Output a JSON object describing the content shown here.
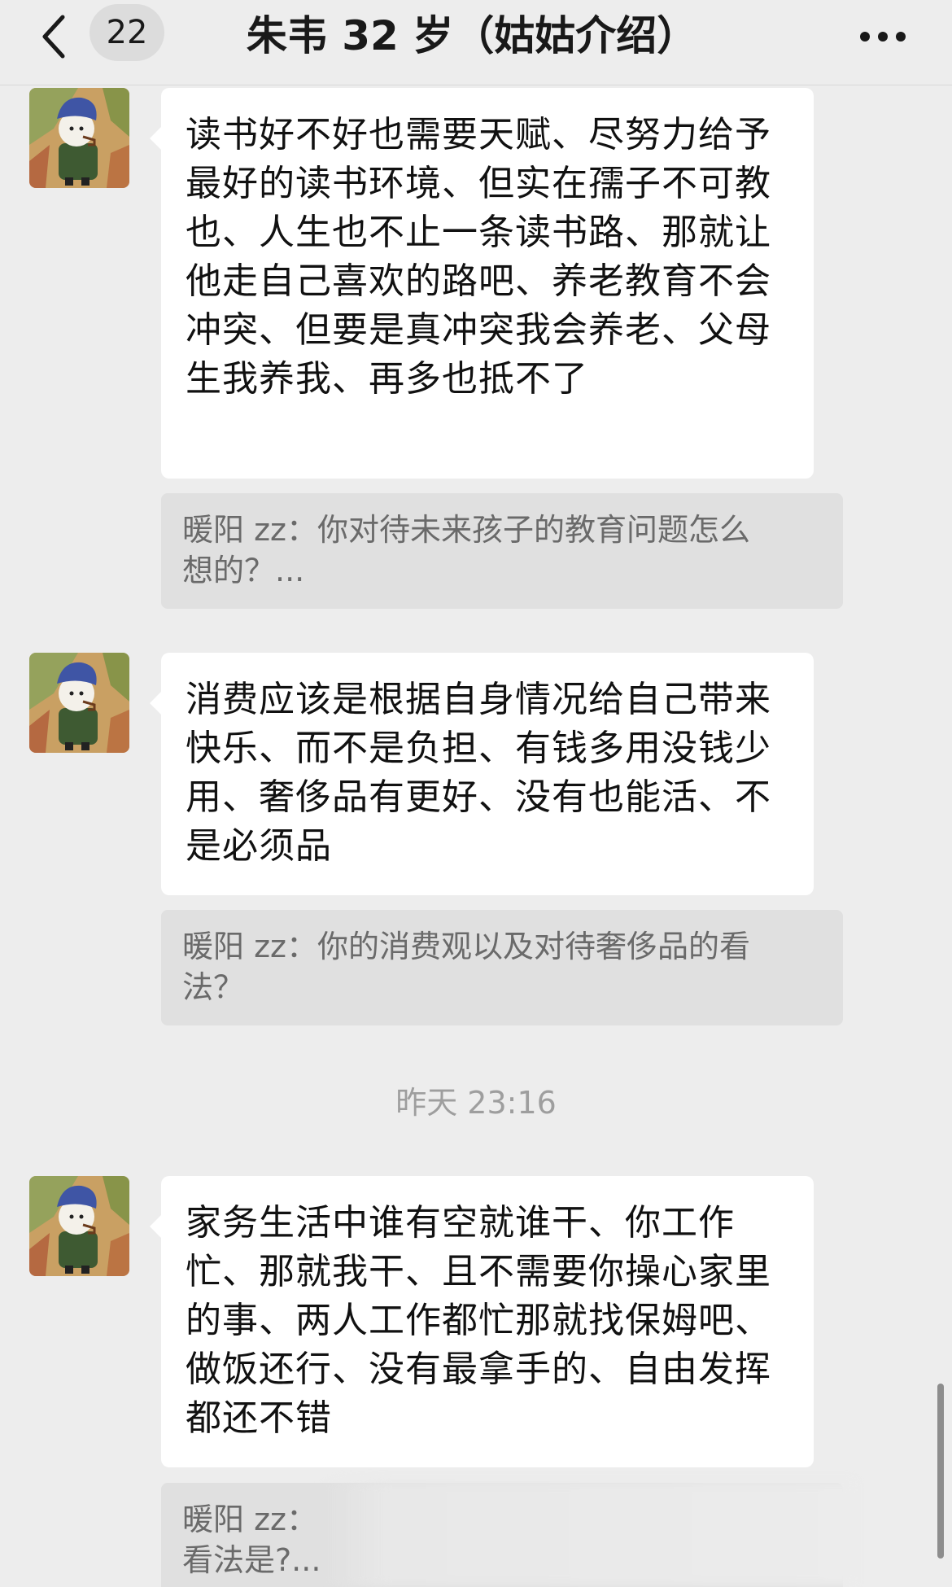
{
  "header": {
    "unread_count": "22",
    "title": "朱韦 32 岁（姑姑介绍）"
  },
  "messages": [
    {
      "text": "读书好不好也需要天赋、尽努力给予最好的读书环境、但实在孺子不可教也、人生也不止一条读书路、那就让他走自己喜欢的路吧、养老教育不会冲突、但要是真冲突我会养老、父母生我养我、再多也抵不了",
      "quote_line1": "暖阳 zz：你对待未来孩子的教育问题怎么",
      "quote_line2": "想的？..."
    },
    {
      "text": "消费应该是根据自身情况给自己带来快乐、而不是负担、有钱多用没钱少用、奢侈品有更好、没有也能活、不是必须品",
      "quote_line1": "暖阳 zz：你的消费观以及对待奢侈品的看",
      "quote_line2": "法？"
    },
    {
      "text": "家务生活中谁有空就谁干、你工作忙、那就我干、且不需要你操心家里的事、两人工作都忙那就找保姆吧、做饭还行、没有最拿手的、自由发挥都还不错",
      "quote_line1": "暖阳 zz：",
      "quote_line2": "看法是?..."
    }
  ],
  "timestamp": "昨天 23:16"
}
